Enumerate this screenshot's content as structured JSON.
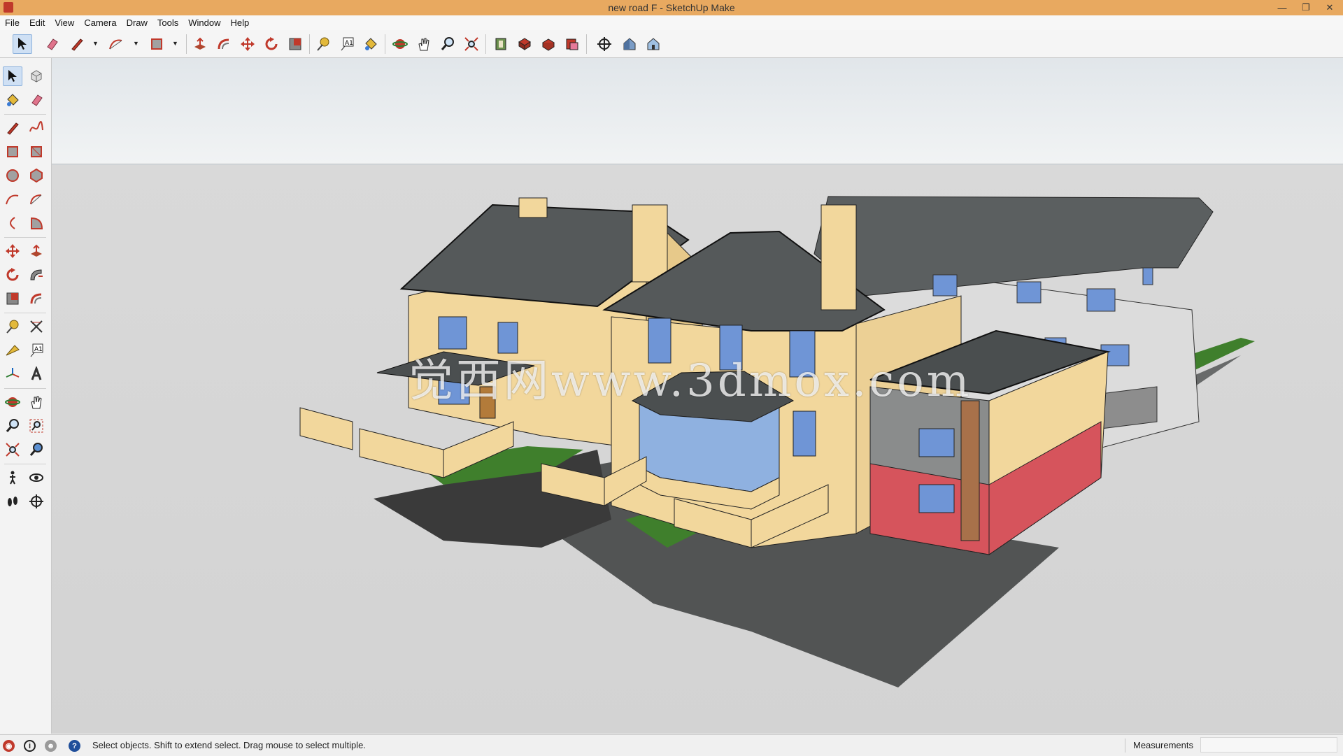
{
  "window": {
    "title": "new road F - SketchUp Make",
    "controls": [
      "minimize-icon",
      "restore-icon",
      "close-icon"
    ]
  },
  "menu": [
    "File",
    "Edit",
    "View",
    "Camera",
    "Draw",
    "Tools",
    "Window",
    "Help"
  ],
  "top_toolbar": [
    {
      "name": "select-tool",
      "active": true
    },
    {
      "name": "eraser-tool"
    },
    {
      "name": "line-tool",
      "dropdown": true
    },
    {
      "name": "arc-tool",
      "dropdown": true
    },
    {
      "name": "rectangle-tool",
      "dropdown": true
    },
    {
      "name": "push-pull-tool"
    },
    {
      "name": "offset-tool"
    },
    {
      "name": "move-tool"
    },
    {
      "name": "rotate-tool"
    },
    {
      "name": "scale-tool"
    },
    {
      "name": "tape-measure-tool"
    },
    {
      "name": "text-tool"
    },
    {
      "name": "paint-bucket-tool"
    },
    {
      "name": "orbit-tool"
    },
    {
      "name": "pan-tool"
    },
    {
      "name": "zoom-tool"
    },
    {
      "name": "zoom-extents-tool"
    },
    {
      "name": "3d-warehouse-button"
    },
    {
      "name": "extension-warehouse-button"
    },
    {
      "name": "share-model-button"
    },
    {
      "name": "layout-button"
    },
    {
      "name": "position-camera-tool"
    },
    {
      "name": "look-around-tool"
    },
    {
      "name": "walk-tool"
    }
  ],
  "left_toolbar": [
    [
      "select-tool",
      "make-component-tool"
    ],
    [
      "paint-bucket-tool",
      "eraser-tool"
    ],
    [
      "line-tool",
      "freehand-tool"
    ],
    [
      "rectangle-tool",
      "rotated-rectangle-tool"
    ],
    [
      "circle-tool",
      "polygon-tool"
    ],
    [
      "arc-tool",
      "two-point-arc-tool"
    ],
    [
      "three-point-arc-tool",
      "pie-tool"
    ],
    [
      "move-tool",
      "push-pull-tool"
    ],
    [
      "rotate-tool",
      "follow-me-tool"
    ],
    [
      "scale-tool",
      "offset-tool"
    ],
    [
      "tape-measure-tool",
      "dimension-tool"
    ],
    [
      "protractor-tool",
      "text-tool"
    ],
    [
      "axes-tool",
      "3d-text-tool"
    ],
    [
      "orbit-tool",
      "pan-tool"
    ],
    [
      "zoom-tool",
      "zoom-window-tool"
    ],
    [
      "zoom-extents-tool",
      "previous-view-tool"
    ],
    [
      "position-camera-tool",
      "look-around-tool"
    ],
    [
      "walk-tool",
      "section-plane-tool"
    ]
  ],
  "viewport": {
    "watermark": "觉西网www.3dmox.com",
    "model": "houses"
  },
  "status": {
    "text": "Select objects. Shift to extend select. Drag mouse to select multiple.",
    "measurements_label": "Measurements",
    "measurements_value": ""
  },
  "colors": {
    "titlebar": "#e8a960",
    "roof": "#55595a",
    "wall": "#f2d79c",
    "window": "#6f95d6",
    "red_wall": "#d6545c",
    "grass": "#3d7a2a",
    "ground": "#d3d3d3"
  }
}
